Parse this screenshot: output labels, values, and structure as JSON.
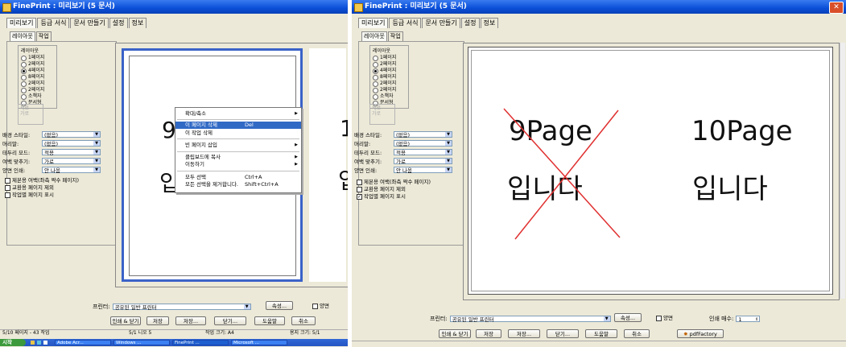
{
  "left_window": {
    "title": "FinePrint : 미리보기 (5 문서)",
    "menu_tabs": [
      "미리보기",
      "등급 서식",
      "문서 만들기",
      "설정",
      "정보"
    ],
    "sub_tabs": [
      "레이아웃",
      "작업"
    ],
    "layout_group": {
      "label": "레이아웃",
      "options": [
        "1페이지",
        "2페이지",
        "4페이지",
        "8페이지",
        "2페이지",
        "2페이지",
        "소책자",
        "문서형"
      ],
      "selected_index": 2
    },
    "orientation_group": [
      "세로",
      "가로"
    ],
    "settings": [
      {
        "label": "배경 스타일:",
        "value": "(없음)"
      },
      {
        "label": "머리말:",
        "value": "(없음)"
      },
      {
        "label": "테두리 모드:",
        "value": "적용"
      },
      {
        "label": "여백 맞추기:",
        "value": "가로"
      },
      {
        "label": "양면 인쇄:",
        "value": "안 나옴"
      }
    ],
    "checkboxes": [
      {
        "label": "제본용 여백(좌측 짝수 페이지)",
        "checked": false
      },
      {
        "label": "교환용 페이지 제외",
        "checked": false
      },
      {
        "label": "작업별 페이지 표시",
        "checked": false
      }
    ],
    "page_text_partial_top": "9",
    "page_text_partial_bottom": "입",
    "next_page_partial_top": "1",
    "next_page_partial_bottom": "입",
    "context_menu": [
      {
        "label": "확대/축소",
        "shortcut": "",
        "submenu": true
      },
      {
        "label": "이 페이지 삭제",
        "shortcut": "Del",
        "submenu": false,
        "highlighted": true
      },
      {
        "label": "이 작업 삭제",
        "shortcut": "",
        "submenu": false
      },
      {
        "label": "빈 페이지 삽입",
        "shortcut": "",
        "submenu": true
      },
      {
        "label": "클립보드에 복사",
        "shortcut": "",
        "submenu": true
      },
      {
        "label": "이동하기",
        "shortcut": "",
        "submenu": true
      },
      {
        "label": "모두 선택",
        "shortcut": "Ctrl+A",
        "submenu": false
      },
      {
        "label": "모든 선택을 제거합니다.",
        "shortcut": "Shift+Ctrl+A",
        "submenu": false
      }
    ],
    "printer_label": "프린터:",
    "printer_value": "공유된 일반 프린터",
    "properties_button": "속성...",
    "duplex_label": "양면",
    "buttons": [
      "인쇄 & 닫기",
      "저장",
      "저장...",
      "닫기...",
      "도움말",
      "취소"
    ],
    "status": [
      "5/10 페이지 - 43 작업",
      "5/1 니오 5",
      "작업 크기: A4",
      "용지 크기: 5/1"
    ],
    "taskbar": {
      "start": "시작",
      "items": [
        "Adobe Acr...",
        "Windows ...",
        "FinePrint ...",
        "Microsoft ..."
      ]
    }
  },
  "right_window": {
    "title": "FinePrint : 미리보기 (5 문서)",
    "menu_tabs": [
      "미리보기",
      "등급 서식",
      "문서 만들기",
      "설정",
      "정보"
    ],
    "sub_tabs": [
      "레이아웃",
      "작업"
    ],
    "layout_group": {
      "label": "레이아웃",
      "options": [
        "1페이지",
        "2페이지",
        "4페이지",
        "8페이지",
        "2페이지",
        "2페이지",
        "소책자",
        "문서형"
      ],
      "selected_index": 2
    },
    "orientation_group": [
      "세로",
      "가로"
    ],
    "settings": [
      {
        "label": "배경 스타일:",
        "value": "(없음)"
      },
      {
        "label": "머리말:",
        "value": "(없음)"
      },
      {
        "label": "테두리 모드:",
        "value": "적용"
      },
      {
        "label": "여백 맞추기:",
        "value": "가로"
      },
      {
        "label": "양면 인쇄:",
        "value": "안 나옴"
      }
    ],
    "checkboxes": [
      {
        "label": "제본용 여백(좌측 짝수 페이지)",
        "checked": false
      },
      {
        "label": "교환용 페이지 제외",
        "checked": false
      },
      {
        "label": "작업별 페이지 표시",
        "checked": true
      }
    ],
    "page1_line1": "9Page",
    "page1_line2": "입니다",
    "page2_line1": "10Page",
    "page2_line2": "입니다",
    "printer_label": "프린터:",
    "printer_value": "공유된 일반 프린터",
    "properties_button": "속성...",
    "duplex_label": "양면",
    "copies_label": "인쇄 매수:",
    "copies_value": "1",
    "buttons": [
      "인쇄 & 닫기",
      "저장",
      "저장...",
      "닫기...",
      "도움말",
      "취소"
    ],
    "factory_button": "pdfFactory",
    "colors": {
      "delete_mark": "#e03030",
      "highlight": "#316ac5",
      "page_border": "#3a62c8"
    }
  }
}
